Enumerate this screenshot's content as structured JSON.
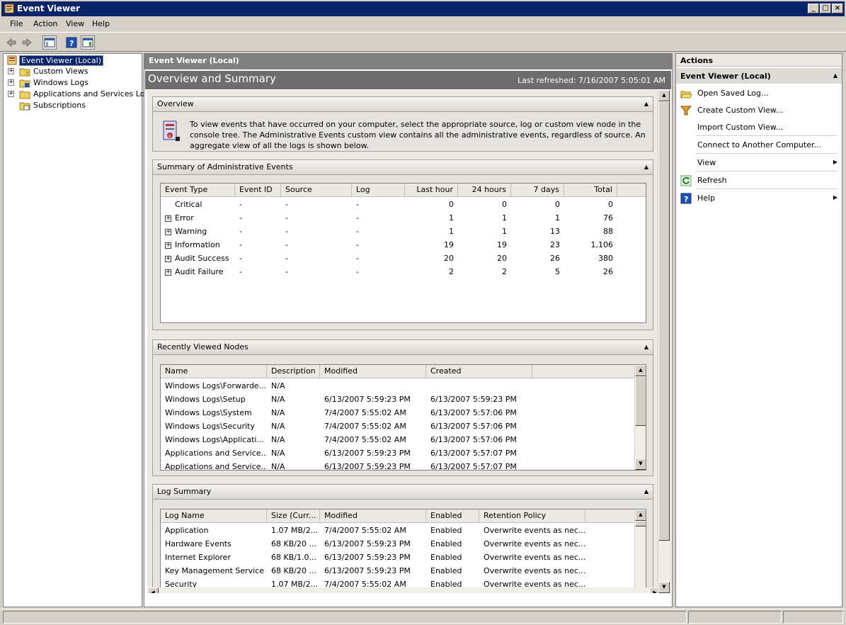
{
  "window": {
    "title": "Event Viewer"
  },
  "menu": [
    "File",
    "Action",
    "View",
    "Help"
  ],
  "tree": [
    {
      "label": "Event Viewer (Local)",
      "selected": true,
      "expander": false
    },
    {
      "label": "Custom Views",
      "expander": true
    },
    {
      "label": "Windows Logs",
      "expander": true
    },
    {
      "label": "Applications and Services Logs",
      "expander": true
    },
    {
      "label": "Subscriptions",
      "expander": false
    }
  ],
  "center": {
    "header": "Event Viewer (Local)",
    "title": "Overview and Summary",
    "refreshed": "Last refreshed: 7/16/2007 5:05:01 AM"
  },
  "overview": {
    "title": "Overview",
    "text": "To view events that have occurred on your computer, select the appropriate source, log or custom view node in the console tree. The Administrative Events custom view contains all the administrative events, regardless of source. An aggregate view of all the logs is shown below."
  },
  "summary": {
    "title": "Summary of Administrative Events",
    "columns": [
      "Event Type",
      "Event ID",
      "Source",
      "Log",
      "Last hour",
      "24 hours",
      "7 days",
      "Total"
    ],
    "rows": [
      {
        "type": "Critical",
        "expand": false,
        "id": "-",
        "source": "-",
        "log": "-",
        "hour": "0",
        "day": "0",
        "week": "0",
        "total": "0"
      },
      {
        "type": "Error",
        "expand": true,
        "id": "-",
        "source": "-",
        "log": "-",
        "hour": "1",
        "day": "1",
        "week": "1",
        "total": "76"
      },
      {
        "type": "Warning",
        "expand": true,
        "id": "-",
        "source": "-",
        "log": "-",
        "hour": "1",
        "day": "1",
        "week": "13",
        "total": "88"
      },
      {
        "type": "Information",
        "expand": true,
        "id": "-",
        "source": "-",
        "log": "-",
        "hour": "19",
        "day": "19",
        "week": "23",
        "total": "1,106"
      },
      {
        "type": "Audit Success",
        "expand": true,
        "id": "-",
        "source": "-",
        "log": "-",
        "hour": "20",
        "day": "20",
        "week": "26",
        "total": "380"
      },
      {
        "type": "Audit Failure",
        "expand": true,
        "id": "-",
        "source": "-",
        "log": "-",
        "hour": "2",
        "day": "2",
        "week": "5",
        "total": "26"
      }
    ]
  },
  "recent": {
    "title": "Recently Viewed Nodes",
    "columns": [
      "Name",
      "Description",
      "Modified",
      "Created"
    ],
    "rows": [
      [
        "Windows Logs\\Forwarde...",
        "N/A",
        "",
        ""
      ],
      [
        "Windows Logs\\Setup",
        "N/A",
        "6/13/2007 5:59:23 PM",
        "6/13/2007 5:59:23 PM"
      ],
      [
        "Windows Logs\\System",
        "N/A",
        "7/4/2007 5:55:02 AM",
        "6/13/2007 5:57:06 PM"
      ],
      [
        "Windows Logs\\Security",
        "N/A",
        "7/4/2007 5:55:02 AM",
        "6/13/2007 5:57:06 PM"
      ],
      [
        "Windows Logs\\Applicati...",
        "N/A",
        "7/4/2007 5:55:02 AM",
        "6/13/2007 5:57:06 PM"
      ],
      [
        "Applications and Service...",
        "N/A",
        "6/13/2007 5:59:23 PM",
        "6/13/2007 5:57:07 PM"
      ],
      [
        "Applications and Service...",
        "N/A",
        "6/13/2007 5:59:23 PM",
        "6/13/2007 5:57:07 PM"
      ]
    ]
  },
  "logsummary": {
    "title": "Log Summary",
    "columns": [
      "Log Name",
      "Size (Curr...",
      "Modified",
      "Enabled",
      "Retention Policy"
    ],
    "rows": [
      [
        "Application",
        "1.07 MB/2...",
        "7/4/2007 5:55:02 AM",
        "Enabled",
        "Overwrite events as nec..."
      ],
      [
        "Hardware Events",
        "68 KB/20 ...",
        "6/13/2007 5:59:23 PM",
        "Enabled",
        "Overwrite events as nec..."
      ],
      [
        "Internet Explorer",
        "68 KB/1.0...",
        "6/13/2007 5:59:23 PM",
        "Enabled",
        "Overwrite events as nec..."
      ],
      [
        "Key Management Service",
        "68 KB/20 ...",
        "6/13/2007 5:59:23 PM",
        "Enabled",
        "Overwrite events as nec..."
      ],
      [
        "Security",
        "1.07 MB/2...",
        "7/4/2007 5:55:02 AM",
        "Enabled",
        "Overwrite events as nec..."
      ]
    ]
  },
  "actions": {
    "header": "Actions",
    "group": "Event Viewer (Local)",
    "items": [
      {
        "label": "Open Saved Log...",
        "icon": "open-log-icon",
        "submenu": false
      },
      {
        "label": "Create Custom View...",
        "icon": "filter-icon",
        "submenu": false
      },
      {
        "label": "Import Custom View...",
        "icon": "",
        "submenu": false
      },
      {
        "label": "Connect to Another Computer...",
        "icon": "",
        "submenu": false
      },
      {
        "label": "View",
        "icon": "",
        "submenu": true
      },
      {
        "label": "Refresh",
        "icon": "refresh-icon",
        "submenu": false
      },
      {
        "label": "Help",
        "icon": "help-icon",
        "submenu": true
      }
    ]
  }
}
